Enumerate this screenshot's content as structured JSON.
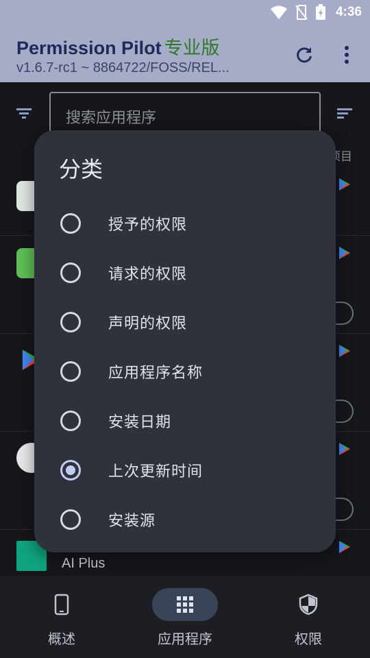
{
  "status_bar": {
    "time": "4:36"
  },
  "app_bar": {
    "title": "Permission Pilot",
    "title_badge": "专业版",
    "subtitle": "v1.6.7-rc1 ~ 8864722/FOSS/REL..."
  },
  "search": {
    "placeholder": "搜索应用程序"
  },
  "list_header": {
    "items_label": "项目"
  },
  "apps": [
    {
      "name": ""
    },
    {
      "name": ""
    },
    {
      "name": ""
    },
    {
      "name": ""
    },
    {
      "name": "AI Plus"
    }
  ],
  "dialog": {
    "title": "分类",
    "options": [
      {
        "label": "授予的权限",
        "checked": false
      },
      {
        "label": "请求的权限",
        "checked": false
      },
      {
        "label": "声明的权限",
        "checked": false
      },
      {
        "label": "应用程序名称",
        "checked": false
      },
      {
        "label": "安装日期",
        "checked": false
      },
      {
        "label": "上次更新时间",
        "checked": true
      },
      {
        "label": "安装源",
        "checked": false
      }
    ]
  },
  "bottom_nav": {
    "items": [
      {
        "label": "概述",
        "icon": "phone-icon",
        "active": false
      },
      {
        "label": "应用程序",
        "icon": "grid-icon",
        "active": true
      },
      {
        "label": "权限",
        "icon": "shield-icon",
        "active": false
      }
    ]
  },
  "colors": {
    "appbar_dimmed": "#a6acc8",
    "dialog_bg": "#2f323b",
    "radio_checked": "#c3cdf3",
    "badge_green": "#2f7a2a"
  }
}
